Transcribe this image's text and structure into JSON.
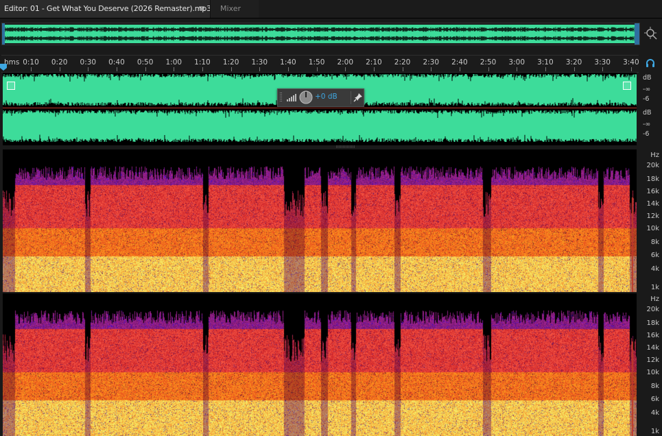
{
  "tabs": {
    "editor_label": "Editor: 01 - Get What You Deserve (2026 Remaster).mp3",
    "mixer_label": "Mixer"
  },
  "icons": {
    "tab_menu": "hamburger-menu-icon",
    "zoom": "zoom-navigator-icon",
    "headphones": "headphones-icon",
    "hud_pin": "pin-icon"
  },
  "ruler": {
    "unit": "hms",
    "ticks": [
      "0:10",
      "0:20",
      "0:30",
      "0:40",
      "0:50",
      "1:00",
      "1:10",
      "1:20",
      "1:30",
      "1:40",
      "1:50",
      "2:00",
      "2:10",
      "2:20",
      "2:30",
      "2:40",
      "2:50",
      "3:00",
      "3:10",
      "3:20",
      "3:30",
      "3:40"
    ]
  },
  "waveform": {
    "db_ruler": [
      "dB",
      "-∞",
      "-6"
    ],
    "hud_value": "+0 dB"
  },
  "spectrogram": {
    "hz_labels": [
      "Hz",
      "20k",
      "18k",
      "16k",
      "14k",
      "12k",
      "10k",
      "8k",
      "6k",
      "4k",
      "1k"
    ]
  },
  "colors": {
    "waveform": "#3ddc9a",
    "accent": "#3ea6e0",
    "spec_low": "#ffd860",
    "spec_mid": "#e63a1c",
    "spec_high": "#6b1f7a"
  }
}
